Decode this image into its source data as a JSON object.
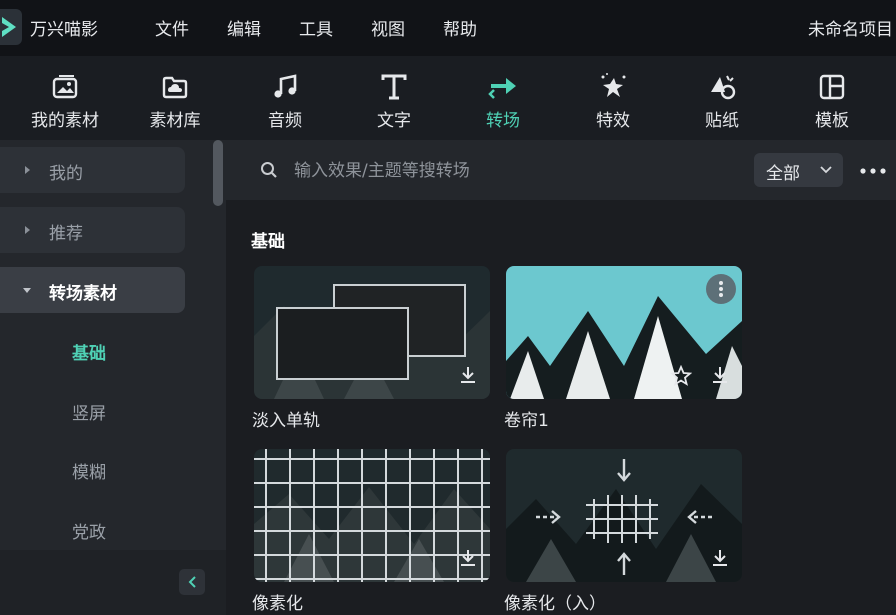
{
  "app": {
    "name": "万兴喵影",
    "project_title": "未命名项目"
  },
  "menu": [
    "文件",
    "编辑",
    "工具",
    "视图",
    "帮助"
  ],
  "toolbar": {
    "items": [
      {
        "label": "我的素材",
        "icon": "my-media-icon"
      },
      {
        "label": "素材库",
        "icon": "stock-library-icon"
      },
      {
        "label": "音频",
        "icon": "music-note-icon"
      },
      {
        "label": "文字",
        "icon": "text-icon"
      },
      {
        "label": "转场",
        "icon": "transition-arrows-icon",
        "active": true
      },
      {
        "label": "特效",
        "icon": "effects-sparkle-icon"
      },
      {
        "label": "贴纸",
        "icon": "sticker-icon"
      },
      {
        "label": "模板",
        "icon": "template-icon"
      }
    ],
    "accent_color": "#4fd1b5"
  },
  "sidebar": {
    "groups": [
      {
        "label": "我的",
        "expanded": false
      },
      {
        "label": "推荐",
        "expanded": false
      },
      {
        "label": "转场素材",
        "expanded": true
      }
    ],
    "subitems": [
      {
        "label": "基础",
        "active": true
      },
      {
        "label": "竖屏"
      },
      {
        "label": "模糊"
      },
      {
        "label": "党政"
      }
    ]
  },
  "search": {
    "placeholder": "输入效果/主题等搜转场",
    "filter_value": "全部"
  },
  "section": {
    "title": "基础"
  },
  "cards": [
    {
      "label": "淡入单轨"
    },
    {
      "label": "卷帘1"
    },
    {
      "label": "像素化"
    },
    {
      "label": "像素化（入）"
    }
  ]
}
